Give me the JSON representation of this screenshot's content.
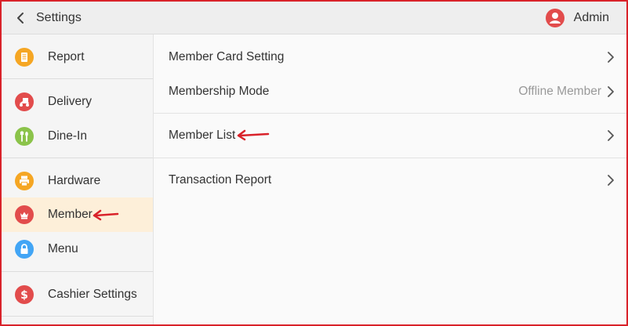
{
  "header": {
    "title": "Settings",
    "user_name": "Admin"
  },
  "sidebar": {
    "items": [
      {
        "label": "Report",
        "icon": "report-icon",
        "color": "#f5a623"
      },
      {
        "label": "Delivery",
        "icon": "scooter-icon",
        "color": "#e24c4c"
      },
      {
        "label": "Dine-In",
        "icon": "utensils-icon",
        "color": "#8bc34a"
      },
      {
        "label": "Hardware",
        "icon": "printer-icon",
        "color": "#f5a623"
      },
      {
        "label": "Member",
        "icon": "crown-icon",
        "color": "#e24c4c",
        "active": true
      },
      {
        "label": "Menu",
        "icon": "lock-icon",
        "color": "#42a5f5"
      },
      {
        "label": "Cashier Settings",
        "icon": "dollar-icon",
        "color": "#e24c4c"
      }
    ]
  },
  "main": {
    "rows": [
      {
        "label": "Member Card Setting",
        "value": ""
      },
      {
        "label": "Membership Mode",
        "value": "Offline Member"
      },
      {
        "label": "Member List",
        "value": ""
      },
      {
        "label": "Transaction Report",
        "value": ""
      }
    ]
  },
  "colors": {
    "accent_red": "#d9222a",
    "active_bg": "#fdefd9",
    "topbar_bg": "#eeeeee"
  }
}
